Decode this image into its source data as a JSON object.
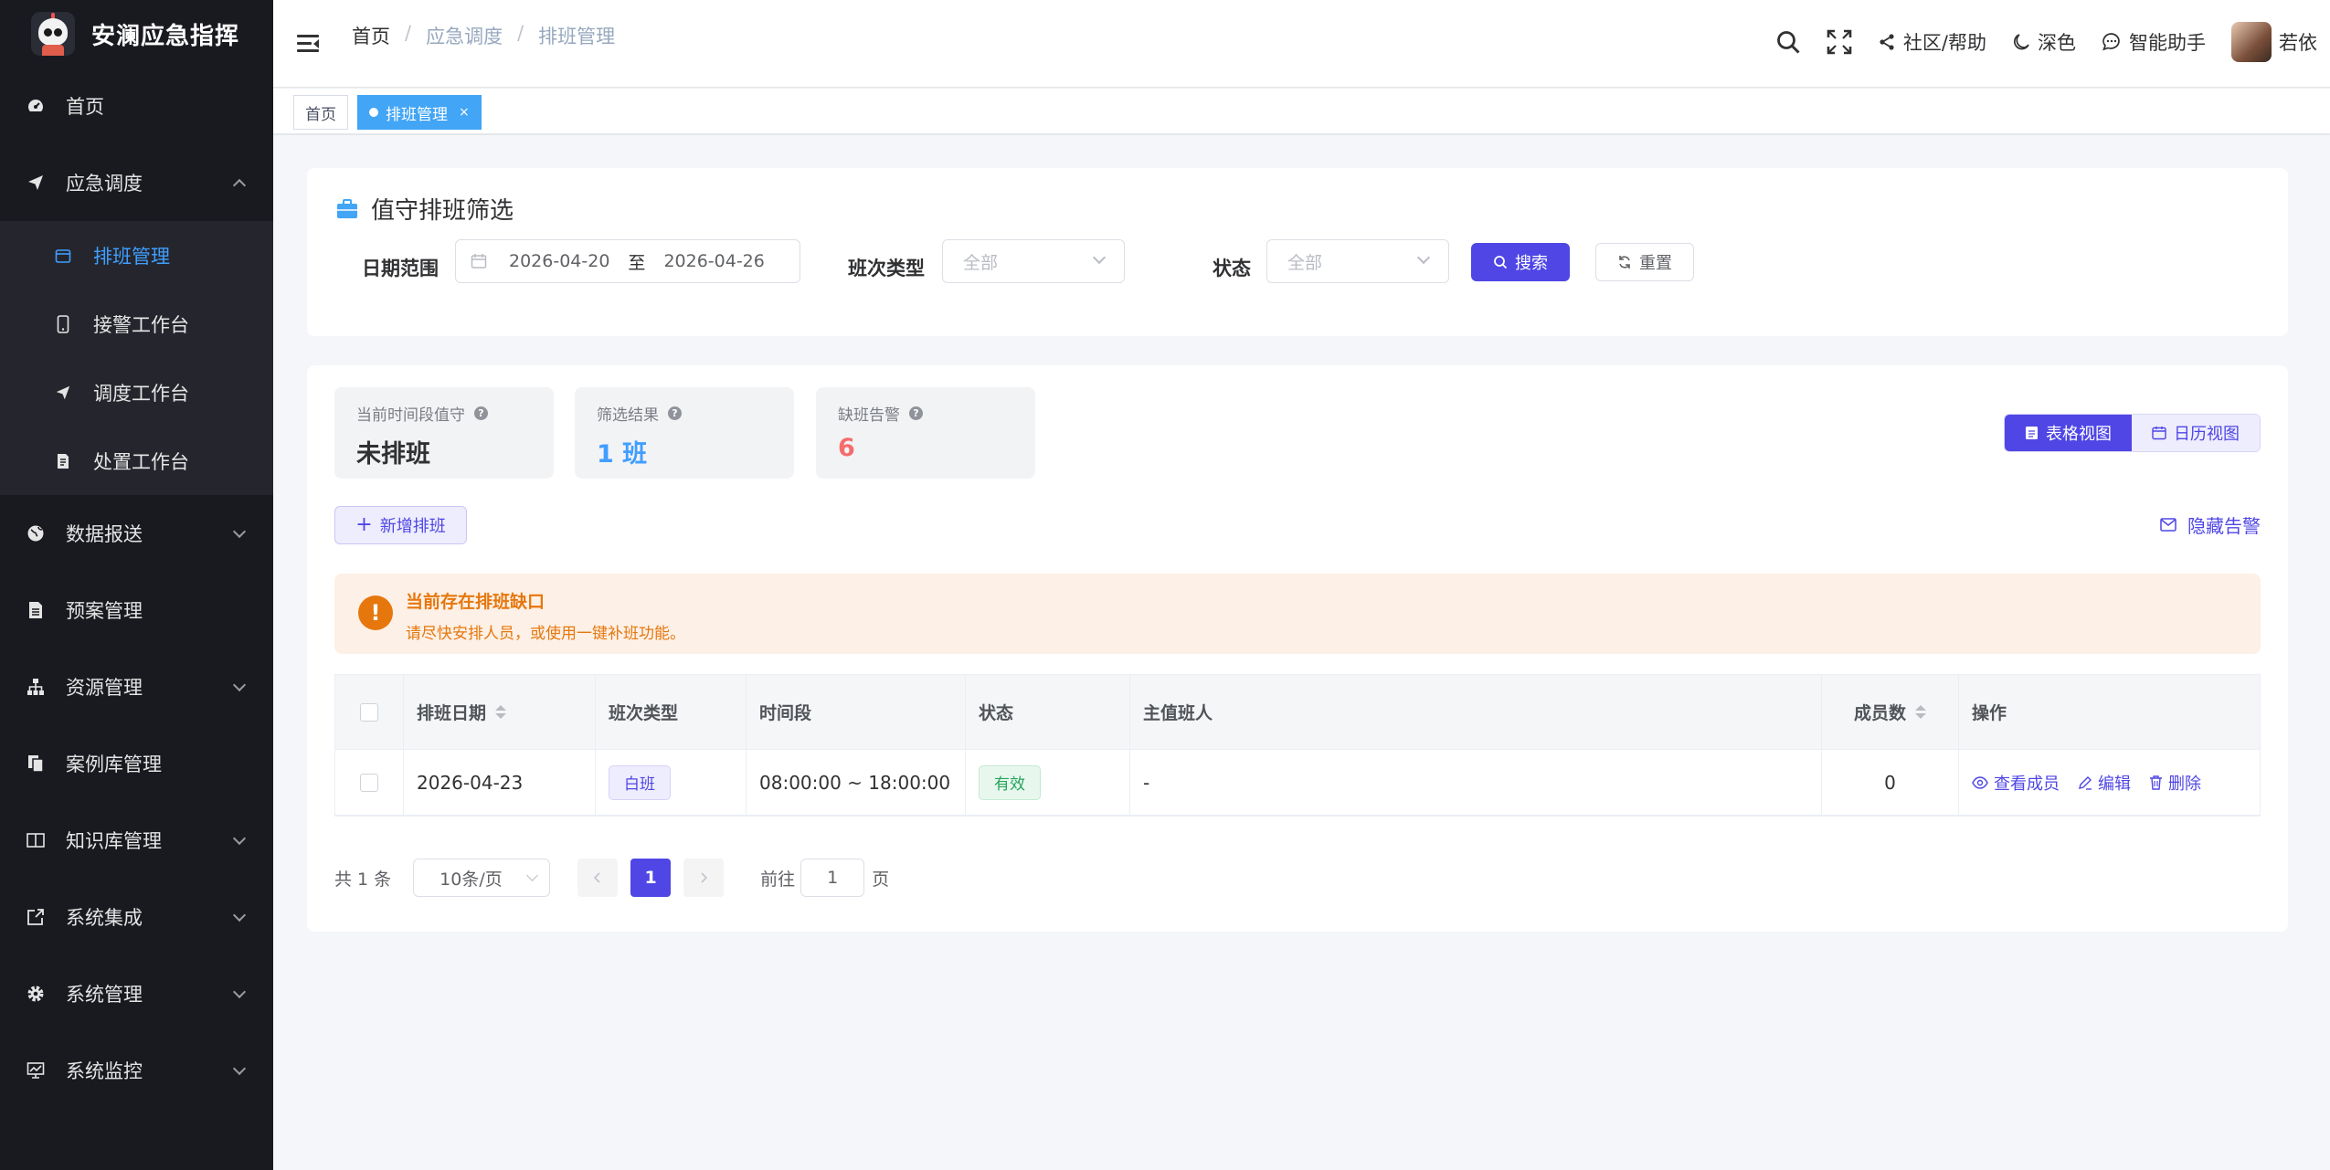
{
  "app": {
    "title": "安澜应急指挥"
  },
  "sidebar": {
    "items": [
      {
        "label": "首页",
        "icon": "dashboard-icon"
      },
      {
        "label": "应急调度",
        "icon": "send-icon",
        "expanded": true,
        "children": [
          {
            "label": "排班管理",
            "icon": "calendar-icon",
            "active": true
          },
          {
            "label": "接警工作台",
            "icon": "phone-icon"
          },
          {
            "label": "调度工作台",
            "icon": "send-icon"
          },
          {
            "label": "处置工作台",
            "icon": "document-edit-icon"
          }
        ]
      },
      {
        "label": "数据报送",
        "icon": "globe-icon"
      },
      {
        "label": "预案管理",
        "icon": "file-icon"
      },
      {
        "label": "资源管理",
        "icon": "sitemap-icon"
      },
      {
        "label": "案例库管理",
        "icon": "copy-icon"
      },
      {
        "label": "知识库管理",
        "icon": "book-icon"
      },
      {
        "label": "系统集成",
        "icon": "external-link-icon"
      },
      {
        "label": "系统管理",
        "icon": "gear-icon"
      },
      {
        "label": "系统监控",
        "icon": "monitor-icon"
      }
    ]
  },
  "header": {
    "breadcrumb": [
      "首页",
      "应急调度",
      "排班管理"
    ],
    "community": "社区/帮助",
    "theme": "深色",
    "assistant": "智能助手",
    "username": "若依"
  },
  "tags": [
    {
      "label": "首页"
    },
    {
      "label": "排班管理",
      "active": true,
      "close": "×"
    }
  ],
  "filter": {
    "title": "值守排班筛选",
    "date_label": "日期范围",
    "date_start": "2026-04-20",
    "date_to": "至",
    "date_end": "2026-04-26",
    "shift_label": "班次类型",
    "shift_value": "全部",
    "status_label": "状态",
    "status_value": "全部",
    "search_btn": "搜索",
    "reset_btn": "重置"
  },
  "stats": [
    {
      "label": "当前时间段值守",
      "value": "未排班",
      "color": "#303133"
    },
    {
      "label": "筛选结果",
      "value": "1 班",
      "color": "#409eff"
    },
    {
      "label": "缺班告警",
      "value": "6",
      "color": "#f56c6c"
    }
  ],
  "view": {
    "table": "表格视图",
    "calendar": "日历视图"
  },
  "actions": {
    "add": "新增排班",
    "hide_alert": "隐藏告警"
  },
  "alert": {
    "title": "当前存在排班缺口",
    "desc": "请尽快安排人员，或使用一键补班功能。",
    "color": "#e6770d"
  },
  "table": {
    "headers": [
      "排班日期",
      "班次类型",
      "时间段",
      "状态",
      "主值班人",
      "成员数",
      "操作"
    ],
    "rows": [
      {
        "date": "2026-04-23",
        "shift": "白班",
        "time": "08:00:00 ~ 18:00:00",
        "status": "有效",
        "leader": "-",
        "members": "0"
      }
    ],
    "ops": [
      "查看成员",
      "编辑",
      "删除"
    ]
  },
  "pagination": {
    "total": "共 1 条",
    "page_size": "10条/页",
    "current": "1",
    "goto_label": "前往",
    "goto_value": "1",
    "page_unit": "页"
  },
  "colors": {
    "primary": "#4f46e5",
    "accent_blue": "#42a5f5",
    "sidebar_bg": "#191a20"
  }
}
